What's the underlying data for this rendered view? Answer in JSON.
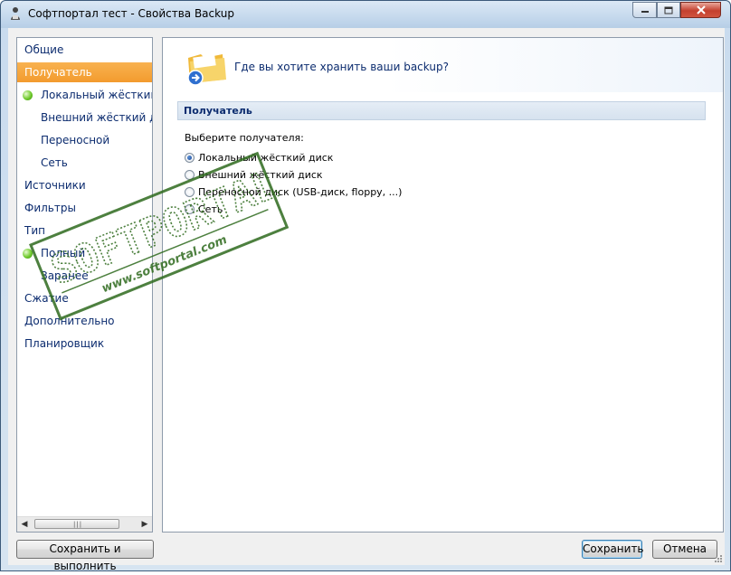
{
  "window": {
    "title": "Софтпортал тест - Свойства Backup"
  },
  "sidebar": {
    "items": [
      {
        "label": "Общие",
        "level": 0,
        "selected": false,
        "status": null
      },
      {
        "label": "Получатель",
        "level": 0,
        "selected": true,
        "status": null
      },
      {
        "label": "Локальный жёсткий д",
        "level": 1,
        "selected": false,
        "status": "green-dot-icon"
      },
      {
        "label": "Внешний жёсткий ди",
        "level": 1,
        "selected": false,
        "status": null
      },
      {
        "label": "Переносной",
        "level": 1,
        "selected": false,
        "status": null
      },
      {
        "label": "Сеть",
        "level": 1,
        "selected": false,
        "status": null
      },
      {
        "label": "Источники",
        "level": 0,
        "selected": false,
        "status": null
      },
      {
        "label": "Фильтры",
        "level": 0,
        "selected": false,
        "status": null
      },
      {
        "label": "Тип",
        "level": 0,
        "selected": false,
        "status": null
      },
      {
        "label": "Полный",
        "level": 1,
        "selected": false,
        "status": "green-dot-icon"
      },
      {
        "label": "Заранее",
        "level": 1,
        "selected": false,
        "status": null
      },
      {
        "label": "Сжатие",
        "level": 0,
        "selected": false,
        "status": null
      },
      {
        "label": "Дополнительно",
        "level": 0,
        "selected": false,
        "status": null
      },
      {
        "label": "Планировщик",
        "level": 0,
        "selected": false,
        "status": null
      }
    ]
  },
  "main": {
    "question": "Где вы хотите хранить ваши backup?",
    "section_title": "Получатель",
    "prompt": "Выберите получателя:",
    "options": [
      {
        "label": "Локальный жёсткий диск",
        "checked": true
      },
      {
        "label": "Внешний жёсткий диск",
        "checked": false
      },
      {
        "label": "Переносной диск (USB-диск, floppy, ...)",
        "checked": false
      },
      {
        "label": "Сеть",
        "checked": false
      }
    ]
  },
  "buttons": {
    "save_and_run": "Сохранить и выполнить",
    "save": "Сохранить",
    "cancel": "Отмена"
  },
  "watermark": {
    "brand": "SOFTPORTAL",
    "url": "www.softportal.com",
    "color": "#2f6b1e"
  },
  "colors": {
    "selection": "#f39b2e",
    "link_text": "#0c2c6f",
    "close_button": "#c4402f"
  }
}
